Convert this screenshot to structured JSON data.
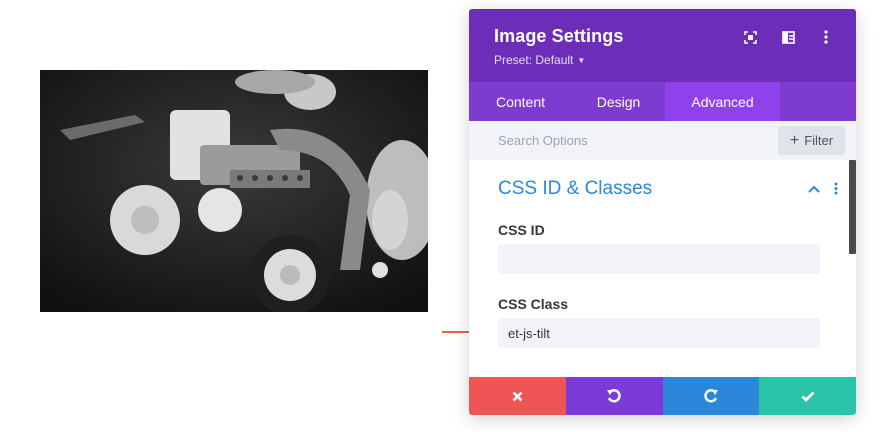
{
  "image": {
    "alt_icon": "photo-construction-toy-robot"
  },
  "panel": {
    "title": "Image Settings",
    "preset_label": "Preset: Default",
    "header_icons": [
      "expand-icon",
      "split-view-icon",
      "more-vertical-icon"
    ]
  },
  "tabs": [
    {
      "label": "Content",
      "active": false
    },
    {
      "label": "Design",
      "active": false
    },
    {
      "label": "Advanced",
      "active": true
    }
  ],
  "search": {
    "placeholder": "Search Options",
    "value": ""
  },
  "filter": {
    "label": "Filter"
  },
  "section": {
    "title": "CSS ID & Classes",
    "fields": [
      {
        "label": "CSS ID",
        "value": ""
      },
      {
        "label": "CSS Class",
        "value": "et-js-tilt"
      }
    ]
  },
  "footer": {
    "buttons": [
      {
        "name": "discard",
        "icon": "close-icon",
        "color": "#ef5555"
      },
      {
        "name": "undo",
        "icon": "undo-icon",
        "color": "#7c3bd8"
      },
      {
        "name": "redo",
        "icon": "redo-icon",
        "color": "#2b87da"
      },
      {
        "name": "save",
        "icon": "check-icon",
        "color": "#29c4a9"
      }
    ]
  },
  "colors": {
    "header": "#6c2eb9",
    "tabs": "#7d3bcf",
    "active_tab": "#8f42ec",
    "section_title": "#2b87da",
    "arrow": "#ef5a4c"
  }
}
